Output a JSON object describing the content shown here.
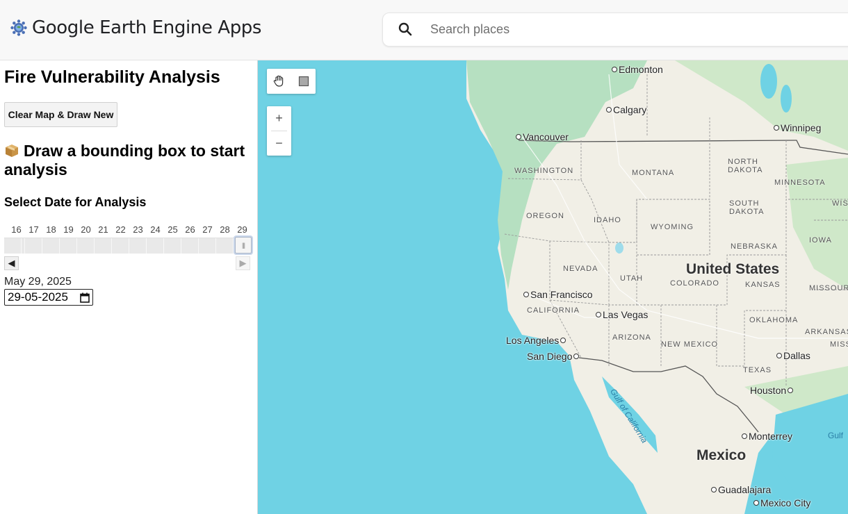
{
  "header": {
    "app_title": "Google Earth Engine Apps",
    "logo_icon": "earth-engine-logo-icon",
    "search": {
      "placeholder": "Search places",
      "value": "",
      "icon": "search-icon"
    }
  },
  "panel": {
    "title": "Fire Vulnerability Analysis",
    "clear_button": "Clear Map & Draw New",
    "hint_icon": "package-icon",
    "hint_text": "Draw a bounding box to start analysis",
    "date_heading": "Select Date for Analysis",
    "slider": {
      "ticks": [
        "16",
        "17",
        "18",
        "19",
        "20",
        "21",
        "22",
        "23",
        "24",
        "25",
        "26",
        "27",
        "28",
        "29"
      ],
      "selected": "29"
    },
    "prev_label": "◀",
    "next_label": "▶",
    "selected_date_text": "May 29, 2025",
    "date_input_value": "29-05-2025"
  },
  "map": {
    "tools": [
      "hand-pan-icon",
      "draw-rectangle-icon"
    ],
    "zoom_in": "+",
    "zoom_out": "−",
    "colors": {
      "water": "#6fd2e4",
      "land": "#f1efe6",
      "forest": "#b6e0c1"
    },
    "cities": [
      "Edmonton",
      "Calgary",
      "Vancouver",
      "Winnipeg",
      "San Francisco",
      "Las Vegas",
      "Los Angeles",
      "San Diego",
      "Dallas",
      "Houston",
      "Monterrey",
      "Guadalajara",
      "Mexico City"
    ],
    "regions": [
      "WASHINGTON",
      "MONTANA",
      "NORTH DAKOTA",
      "MINNESOTA",
      "WISC",
      "OREGON",
      "IDAHO",
      "WYOMING",
      "SOUTH DAKOTA",
      "IOWA",
      "NEBRASKA",
      "NEVADA",
      "UTAH",
      "COLORADO",
      "KANSAS",
      "MISSOURI",
      "CALIFORNIA",
      "OKLAHOMA",
      "ARKANSAS",
      "MISSI",
      "ARIZONA",
      "NEW MEXICO",
      "TEXAS"
    ],
    "countries": [
      "United States",
      "Mexico"
    ],
    "water_labels": [
      "Gulf of California",
      "Gulf"
    ]
  }
}
